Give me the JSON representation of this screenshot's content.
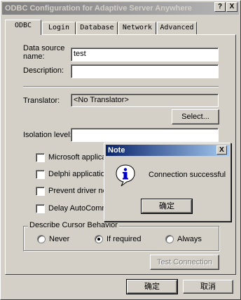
{
  "window": {
    "title": "ODBC Configuration for Adaptive Server Anywhere",
    "help_button": "?",
    "close_button": "X"
  },
  "tabs": [
    {
      "label": "ODBC",
      "active": true
    },
    {
      "label": "Login"
    },
    {
      "label": "Database"
    },
    {
      "label": "Network"
    },
    {
      "label": "Advanced"
    }
  ],
  "odbc": {
    "data_source_name_label_1": "Data source",
    "data_source_name_label_2": "name:",
    "data_source_name_value": "test",
    "description_label": "Description:",
    "description_value": "",
    "translator_label": "Translator:",
    "translator_value": "<No Translator>",
    "select_button": "Select...",
    "isolation_label": "Isolation level:",
    "isolation_value": "",
    "checkboxes": [
      {
        "label": "Microsoft applica",
        "checked": false
      },
      {
        "label": "Delphi applicatio",
        "checked": false
      },
      {
        "label": "Prevent driver no",
        "checked": false
      },
      {
        "label": "Delay AutoComm",
        "checked": false
      }
    ],
    "cursor_group_label": "Describe Cursor Behavior",
    "cursor_options": [
      {
        "label": "Never",
        "selected": false
      },
      {
        "label": "If required",
        "selected": true
      },
      {
        "label": "Always",
        "selected": false
      }
    ],
    "test_connection_button": "Test Connection"
  },
  "footer": {
    "ok_button": "确定",
    "cancel_button": "取消"
  },
  "note_dialog": {
    "title": "Note",
    "close_button": "X",
    "icon": "info-icon",
    "message": "Connection successful",
    "ok_button": "确定"
  }
}
